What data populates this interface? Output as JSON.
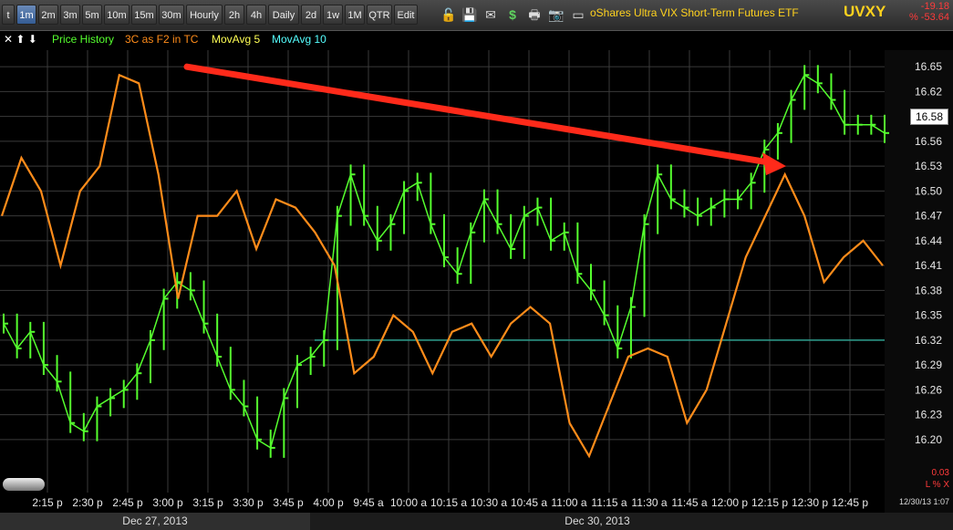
{
  "toolbar": {
    "timeframes": [
      "t",
      "1m",
      "2m",
      "3m",
      "5m",
      "10m",
      "15m",
      "30m",
      "Hourly",
      "2h",
      "4h",
      "Daily",
      "2d",
      "1w",
      "1M",
      "QTR",
      "Edit"
    ],
    "active": "1m",
    "title": "oShares Ultra VIX Short-Term Futures ETF",
    "ticker": "UVXY",
    "change": "-19.18",
    "change_pct": "% -53.64",
    "icons": [
      "lock-icon",
      "save-icon",
      "mail-icon",
      "dollar-icon",
      "print-icon",
      "camera-icon",
      "card-icon",
      "refresh-icon"
    ]
  },
  "legend": {
    "arrows": "✕ ⬆ ⬇",
    "items": [
      {
        "label": "Price History",
        "color": "#55ff2e"
      },
      {
        "label": "3C as F2 in TC",
        "color": "#ff8c1a"
      },
      {
        "label": "MovAvg 5",
        "color": "#ffff55"
      },
      {
        "label": "MovAvg 10",
        "color": "#55ffff"
      }
    ]
  },
  "price_tag": "16.58",
  "small_value": "0.03",
  "lx_label": "L % X",
  "timestamp": "12/30/13 1:07",
  "dates": {
    "d1": "Dec 27, 2013",
    "d2": "Dec 30, 2013"
  },
  "colors": {
    "price": "#55ff2e",
    "indicator": "#ff8c1a",
    "grid": "#3a3a3a",
    "arrow": "#ff2a1a",
    "hline": "#2e9e8e"
  },
  "chart_data": {
    "type": "line",
    "ylim": [
      16.18,
      16.67
    ],
    "y_ticks": [
      16.65,
      16.62,
      16.59,
      16.56,
      16.53,
      16.5,
      16.47,
      16.44,
      16.41,
      16.38,
      16.35,
      16.32,
      16.29,
      16.26,
      16.23,
      16.2
    ],
    "x_ticks": [
      "2:15 p",
      "2:30 p",
      "2:45 p",
      "3:00 p",
      "3:15 p",
      "3:30 p",
      "3:45 p",
      "4:00 p",
      "9:45 a",
      "10:00 a",
      "10:15 a",
      "10:30 a",
      "10:45 a",
      "11:00 a",
      "11:15 a",
      "11:30 a",
      "11:45 a",
      "12:00 p",
      "12:15 p",
      "12:30 p",
      "12:45 p"
    ],
    "horizontal_line": 16.32,
    "price": [
      [
        0,
        16.34
      ],
      [
        1,
        16.31
      ],
      [
        2,
        16.33
      ],
      [
        3,
        16.29
      ],
      [
        4,
        16.27
      ],
      [
        5,
        16.22
      ],
      [
        6,
        16.21
      ],
      [
        7,
        16.24
      ],
      [
        8,
        16.25
      ],
      [
        9,
        16.26
      ],
      [
        10,
        16.28
      ],
      [
        11,
        16.32
      ],
      [
        12,
        16.37
      ],
      [
        13,
        16.39
      ],
      [
        14,
        16.38
      ],
      [
        15,
        16.34
      ],
      [
        16,
        16.3
      ],
      [
        17,
        16.26
      ],
      [
        18,
        16.24
      ],
      [
        19,
        16.2
      ],
      [
        20,
        16.19
      ],
      [
        21,
        16.25
      ],
      [
        22,
        16.29
      ],
      [
        23,
        16.3
      ],
      [
        24,
        16.32
      ],
      [
        25,
        16.47
      ],
      [
        26,
        16.52
      ],
      [
        27,
        16.47
      ],
      [
        28,
        16.44
      ],
      [
        29,
        16.46
      ],
      [
        30,
        16.5
      ],
      [
        31,
        16.51
      ],
      [
        32,
        16.46
      ],
      [
        33,
        16.42
      ],
      [
        34,
        16.4
      ],
      [
        35,
        16.45
      ],
      [
        36,
        16.49
      ],
      [
        37,
        16.46
      ],
      [
        38,
        16.43
      ],
      [
        39,
        16.47
      ],
      [
        40,
        16.48
      ],
      [
        41,
        16.44
      ],
      [
        42,
        16.45
      ],
      [
        43,
        16.4
      ],
      [
        44,
        16.38
      ],
      [
        45,
        16.35
      ],
      [
        46,
        16.31
      ],
      [
        47,
        16.36
      ],
      [
        48,
        16.46
      ],
      [
        49,
        16.52
      ],
      [
        50,
        16.49
      ],
      [
        51,
        16.48
      ],
      [
        52,
        16.47
      ],
      [
        53,
        16.48
      ],
      [
        54,
        16.49
      ],
      [
        55,
        16.49
      ],
      [
        56,
        16.51
      ],
      [
        57,
        16.55
      ],
      [
        58,
        16.57
      ],
      [
        59,
        16.61
      ],
      [
        60,
        16.64
      ],
      [
        61,
        16.63
      ],
      [
        62,
        16.61
      ],
      [
        63,
        16.58
      ],
      [
        64,
        16.58
      ],
      [
        65,
        16.58
      ],
      [
        66,
        16.57
      ]
    ],
    "indicator": [
      [
        0,
        16.47
      ],
      [
        1,
        16.54
      ],
      [
        2,
        16.5
      ],
      [
        3,
        16.41
      ],
      [
        4,
        16.5
      ],
      [
        5,
        16.53
      ],
      [
        6,
        16.64
      ],
      [
        7,
        16.63
      ],
      [
        8,
        16.52
      ],
      [
        9,
        16.37
      ],
      [
        10,
        16.47
      ],
      [
        11,
        16.47
      ],
      [
        12,
        16.5
      ],
      [
        13,
        16.43
      ],
      [
        14,
        16.49
      ],
      [
        15,
        16.48
      ],
      [
        16,
        16.45
      ],
      [
        17,
        16.41
      ],
      [
        18,
        16.28
      ],
      [
        19,
        16.3
      ],
      [
        20,
        16.35
      ],
      [
        21,
        16.33
      ],
      [
        22,
        16.28
      ],
      [
        23,
        16.33
      ],
      [
        24,
        16.34
      ],
      [
        25,
        16.3
      ],
      [
        26,
        16.34
      ],
      [
        27,
        16.36
      ],
      [
        28,
        16.34
      ],
      [
        29,
        16.22
      ],
      [
        30,
        16.18
      ],
      [
        31,
        16.24
      ],
      [
        32,
        16.3
      ],
      [
        33,
        16.31
      ],
      [
        34,
        16.3
      ],
      [
        35,
        16.22
      ],
      [
        36,
        16.26
      ],
      [
        37,
        16.34
      ],
      [
        38,
        16.42
      ],
      [
        39,
        16.47
      ],
      [
        40,
        16.52
      ],
      [
        41,
        16.47
      ],
      [
        42,
        16.39
      ],
      [
        43,
        16.42
      ],
      [
        44,
        16.44
      ],
      [
        45,
        16.41
      ]
    ]
  }
}
